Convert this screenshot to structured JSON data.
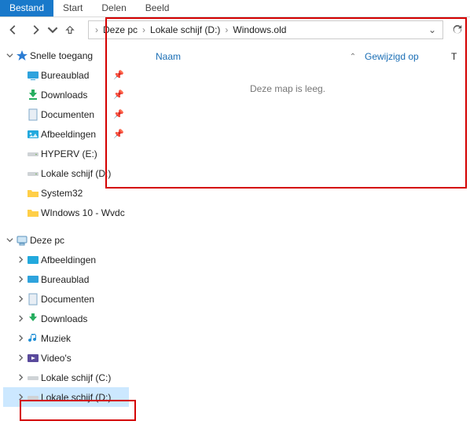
{
  "ribbon": {
    "tabs": [
      "Bestand",
      "Start",
      "Delen",
      "Beeld"
    ],
    "active": 0
  },
  "breadcrumb": {
    "parts": [
      "Deze pc",
      "Lokale schijf (D:)",
      "Windows.old"
    ]
  },
  "columns": {
    "name": "Naam",
    "modified": "Gewijzigd op",
    "type": "T"
  },
  "empty_message": "Deze map is leeg.",
  "tree": {
    "quick": {
      "label": "Snelle toegang",
      "items": [
        {
          "label": "Bureaublad",
          "icon": "desktop",
          "pinned": true
        },
        {
          "label": "Downloads",
          "icon": "download",
          "pinned": true
        },
        {
          "label": "Documenten",
          "icon": "doc",
          "pinned": true
        },
        {
          "label": "Afbeeldingen",
          "icon": "img",
          "pinned": true
        },
        {
          "label": "HYPERV (E:)",
          "icon": "drive",
          "pinned": false
        },
        {
          "label": "Lokale schijf (D:)",
          "icon": "drive",
          "pinned": false
        },
        {
          "label": "System32",
          "icon": "folder",
          "pinned": false
        },
        {
          "label": "WIndows 10 - Wvdc",
          "icon": "folder",
          "pinned": false
        }
      ]
    },
    "thispc": {
      "label": "Deze pc",
      "items": [
        {
          "label": "Afbeeldingen",
          "icon": "img"
        },
        {
          "label": "Bureaublad",
          "icon": "desktop"
        },
        {
          "label": "Documenten",
          "icon": "doc"
        },
        {
          "label": "Downloads",
          "icon": "download"
        },
        {
          "label": "Muziek",
          "icon": "music"
        },
        {
          "label": "Video's",
          "icon": "video"
        },
        {
          "label": "Lokale schijf (C:)",
          "icon": "drive"
        },
        {
          "label": "Lokale schijf (D:)",
          "icon": "drive",
          "selected": true
        }
      ]
    }
  }
}
